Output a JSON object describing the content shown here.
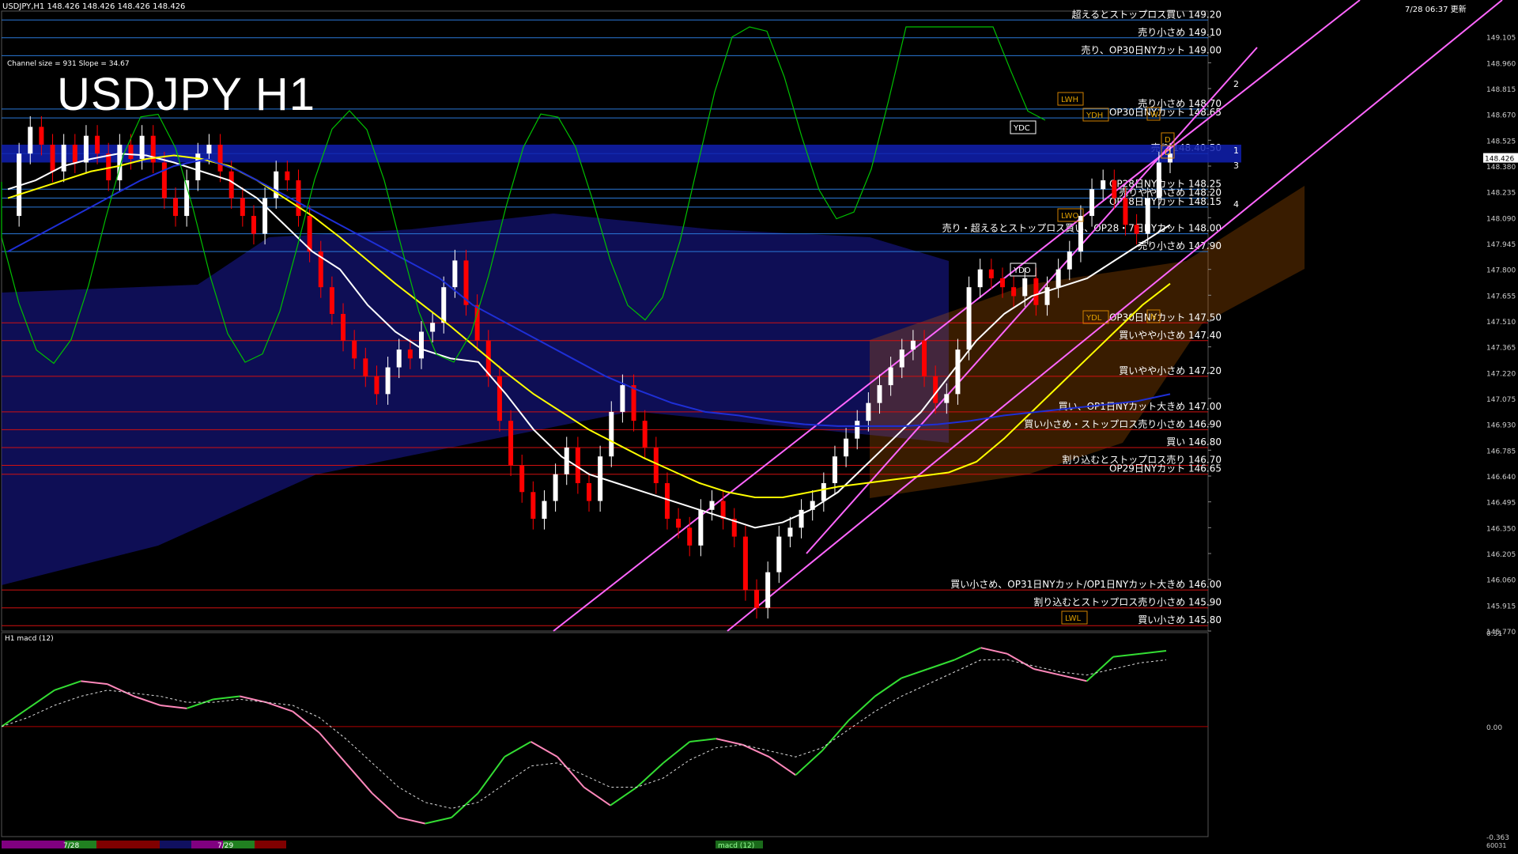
{
  "header": {
    "symbol_line": "USDJPY,H1  148.426 148.426 148.426 148.426",
    "timestamp": "7/28 06:37 更新",
    "channel_info": "Channel size = 931 Slope = 34.67",
    "big_title": "USDJPY H1"
  },
  "colors": {
    "background": "#000000",
    "bull_candle": "#ffffff",
    "bear_candle": "#ff0000",
    "kumo_fill": "#1a1a9a",
    "kumo_lagging": "#cc6600",
    "ma_white": "#ffffff",
    "ma_yellow": "#ffff00",
    "ma_blue": "#1e2fd6",
    "chikou_green": "#00c000",
    "channel_magenta": "#ff66ff",
    "level_blue": "#2a78d8",
    "level_red": "#d01010",
    "macd_green": "#33dd33",
    "macd_pink": "#ff88bb"
  },
  "chart_data": [
    {
      "type": "candlestick",
      "title": "USDJPY H1",
      "ylim": [
        145.77,
        149.25
      ],
      "y_ticks": [
        "149.105",
        "148.960",
        "148.815",
        "148.670",
        "148.525",
        "148.380",
        "148.235",
        "148.090",
        "147.945",
        "147.800",
        "147.655",
        "147.510",
        "147.365",
        "147.220",
        "147.075",
        "146.930",
        "146.785",
        "146.640",
        "146.495",
        "146.350",
        "146.205",
        "146.060",
        "145.915",
        "145.770"
      ],
      "current_price": "148.426",
      "x_labels": [
        "7/28",
        "7/29"
      ],
      "close_path": [
        148.1,
        148.45,
        148.6,
        148.5,
        148.35,
        148.5,
        148.4,
        148.55,
        148.45,
        148.3,
        148.5,
        148.42,
        148.55,
        148.4,
        148.2,
        148.1,
        148.3,
        148.45,
        148.5,
        148.35,
        148.2,
        148.1,
        148.0,
        148.2,
        148.35,
        148.3,
        148.1,
        147.9,
        147.7,
        147.55,
        147.4,
        147.3,
        147.2,
        147.1,
        147.25,
        147.35,
        147.3,
        147.45,
        147.5,
        147.7,
        147.85,
        147.6,
        147.4,
        147.2,
        146.95,
        146.7,
        146.55,
        146.4,
        146.5,
        146.65,
        146.8,
        146.6,
        146.5,
        146.75,
        147.0,
        147.15,
        146.95,
        146.8,
        146.6,
        146.4,
        146.35,
        146.25,
        146.45,
        146.5,
        146.4,
        146.3,
        146.0,
        145.9,
        146.1,
        146.3,
        146.35,
        146.45,
        146.5,
        146.6,
        146.75,
        146.85,
        146.95,
        147.05,
        147.15,
        147.25,
        147.35,
        147.4,
        147.2,
        147.05,
        147.1,
        147.35,
        147.7,
        147.8,
        147.75,
        147.7,
        147.65,
        147.75,
        147.6,
        147.7,
        147.8,
        147.9,
        148.1,
        148.25,
        148.3,
        148.2,
        148.05,
        148.0,
        148.2,
        148.4,
        148.45
      ],
      "series": [
        {
          "name": "",
          "values": [
            148.25,
            148.3,
            148.38,
            148.42,
            148.45,
            148.44,
            148.4,
            148.35,
            148.3,
            148.2,
            148.05,
            147.9,
            147.8,
            147.6,
            147.45,
            147.35,
            147.3,
            147.28,
            147.1,
            146.9,
            146.75,
            146.65,
            146.6,
            146.55,
            146.5,
            146.45,
            146.4,
            146.35,
            146.38,
            146.45,
            146.55,
            146.7,
            146.85,
            147.0,
            147.2,
            147.4,
            147.55,
            147.65,
            147.7,
            147.75,
            147.85,
            147.95,
            148.05
          ]
        },
        {
          "name": "",
          "values": [
            148.2,
            148.25,
            148.3,
            148.35,
            148.38,
            148.42,
            148.44,
            148.42,
            148.38,
            148.3,
            148.2,
            148.1,
            147.98,
            147.85,
            147.72,
            147.6,
            147.48,
            147.35,
            147.22,
            147.1,
            147.0,
            146.9,
            146.82,
            146.74,
            146.67,
            146.6,
            146.55,
            146.52,
            146.52,
            146.55,
            146.58,
            146.6,
            146.62,
            146.64,
            146.66,
            146.72,
            146.85,
            147.0,
            147.15,
            147.3,
            147.45,
            147.6,
            147.72
          ]
        },
        {
          "name": "",
          "values": [
            147.9,
            148.0,
            148.1,
            148.2,
            148.3,
            148.38,
            148.42,
            148.35,
            148.25,
            148.15,
            148.05,
            147.95,
            147.85,
            147.75,
            147.6,
            147.5,
            147.4,
            147.3,
            147.2,
            147.12,
            147.05,
            147.0,
            146.98,
            146.95,
            146.93,
            146.92,
            146.92,
            146.92,
            146.93,
            146.95,
            146.98,
            147.0,
            147.02,
            147.04,
            147.06,
            147.1
          ]
        }
      ],
      "levels": [
        {
          "price": 149.2,
          "label": "超えるとストップロス買い 149.20",
          "color": "blue"
        },
        {
          "price": 149.1,
          "label": "売り小さめ 149.10",
          "color": "blue"
        },
        {
          "price": 149.0,
          "label": "売り、OP30日NYカット 149.00",
          "color": "blue"
        },
        {
          "price": 148.7,
          "label": "売り小さめ 148.70",
          "color": "blue"
        },
        {
          "price": 148.65,
          "label": "OP30日NYカット 148.65",
          "color": "blue"
        },
        {
          "price": 148.45,
          "label": "売り 148.40-50",
          "color": "blue"
        },
        {
          "price": 148.25,
          "label": "OP28日NYカット 148.25",
          "color": "blue"
        },
        {
          "price": 148.2,
          "label": "売りやや小さめ 148.20",
          "color": "blue"
        },
        {
          "price": 148.15,
          "label": "OP28日NYカット 148.15",
          "color": "blue"
        },
        {
          "price": 148.0,
          "label": "売り・超えるとストップロス買い、OP28・7日NYカット 148.00",
          "color": "blue"
        },
        {
          "price": 147.9,
          "label": "売り小さめ 147.90",
          "color": "blue"
        },
        {
          "price": 147.5,
          "label": "OP30日NYカット 147.50",
          "color": "red"
        },
        {
          "price": 147.4,
          "label": "買いやや小さめ 147.40",
          "color": "red"
        },
        {
          "price": 147.2,
          "label": "買いやや小さめ 147.20",
          "color": "red"
        },
        {
          "price": 147.0,
          "label": "買い、OP1日NYカット大きめ 147.00",
          "color": "red"
        },
        {
          "price": 146.9,
          "label": "買い小さめ・ストップロス売り小さめ 146.90",
          "color": "red"
        },
        {
          "price": 146.8,
          "label": "買い 146.80",
          "color": "red"
        },
        {
          "price": 146.7,
          "label": "割り込むとストップロス売り 146.70",
          "color": "red"
        },
        {
          "price": 146.65,
          "label": "OP29日NYカット 146.65",
          "color": "red"
        },
        {
          "price": 146.0,
          "label": "買い小さめ、OP31日NYカット/OP1日NYカット大きめ 146.00",
          "color": "red"
        },
        {
          "price": 145.9,
          "label": "割り込むとストップロス売り小さめ 145.90",
          "color": "red"
        },
        {
          "price": 145.8,
          "label": "買い小さめ 145.80",
          "color": "red"
        }
      ],
      "box_labels": [
        "YDC",
        "LWH",
        "YDH",
        "YDO",
        "YDL",
        "LWL",
        "LWO",
        "W",
        "D",
        "D",
        "N"
      ],
      "target_numbers": [
        "2",
        "1",
        "3",
        "4"
      ]
    },
    {
      "type": "line",
      "title": "H1 macd (12)",
      "ylim": [
        -0.363,
        0.31
      ],
      "y_ticks": [
        "0.31",
        "0.00",
        "-0.363"
      ],
      "series": [
        {
          "name": "",
          "values": [
            0.0,
            0.06,
            0.12,
            0.15,
            0.14,
            0.1,
            0.07,
            0.06,
            0.09,
            0.1,
            0.08,
            0.05,
            -0.02,
            -0.12,
            -0.22,
            -0.3,
            -0.32,
            -0.3,
            -0.22,
            -0.1,
            -0.05,
            -0.1,
            -0.2,
            -0.26,
            -0.2,
            -0.12,
            -0.05,
            -0.04,
            -0.06,
            -0.1,
            -0.16,
            -0.08,
            0.02,
            0.1,
            0.16,
            0.19,
            0.22,
            0.26,
            0.24,
            0.19,
            0.17,
            0.15,
            0.23,
            0.24,
            0.25
          ]
        },
        {
          "name": "",
          "values": [
            0.0,
            0.03,
            0.07,
            0.1,
            0.12,
            0.11,
            0.1,
            0.08,
            0.08,
            0.09,
            0.08,
            0.07,
            0.03,
            -0.04,
            -0.12,
            -0.2,
            -0.25,
            -0.27,
            -0.25,
            -0.19,
            -0.13,
            -0.12,
            -0.16,
            -0.2,
            -0.2,
            -0.17,
            -0.11,
            -0.07,
            -0.06,
            -0.08,
            -0.1,
            -0.07,
            -0.01,
            0.05,
            0.1,
            0.14,
            0.18,
            0.22,
            0.22,
            0.2,
            0.18,
            0.17,
            0.19,
            0.21,
            0.22
          ]
        }
      ]
    }
  ],
  "footer": {
    "date_1": "7/28",
    "date_2": "7/29",
    "indicator_label": "macd (12)",
    "bottom_right": "60031"
  }
}
